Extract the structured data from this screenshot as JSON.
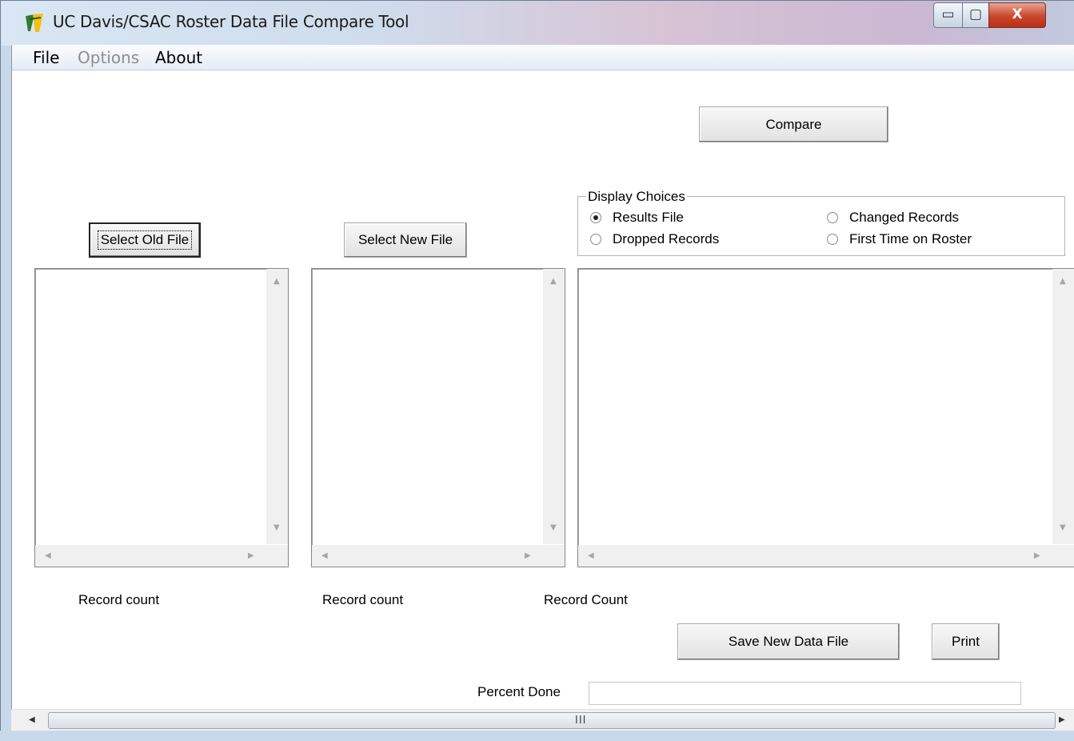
{
  "window": {
    "title": "UC Davis/CSAC Roster Data File Compare Tool",
    "controls": {
      "minimize": "▭",
      "maximize": "▢",
      "close": "X"
    }
  },
  "menu": {
    "items": [
      "File",
      "Options",
      "About"
    ],
    "disabled": [
      "Options"
    ]
  },
  "buttons": {
    "compare": "Compare",
    "select_old": "Select Old File",
    "select_new": "Select New File",
    "save": "Save New Data File",
    "print": "Print"
  },
  "display_choices": {
    "label": "Display Choices",
    "options": [
      "Results File",
      "Dropped Records",
      "Changed Records",
      "First Time on Roster"
    ],
    "selected": "Results File"
  },
  "record_counts": {
    "old": "Record count",
    "new": "Record count",
    "results": "Record Count"
  },
  "progress": {
    "label": "Percent Done",
    "value": 0
  },
  "scrollbar": {
    "grip": "III"
  },
  "icons": {
    "app": "app-logo-icon",
    "scroll_up": "▲",
    "scroll_down": "▼",
    "scroll_left": "◀",
    "scroll_right": "▶"
  },
  "colors": {
    "titlebar": "#cfdcec",
    "close": "#c9462d",
    "menubar": "#e5ecf6",
    "window_bg": "#ffffff"
  }
}
